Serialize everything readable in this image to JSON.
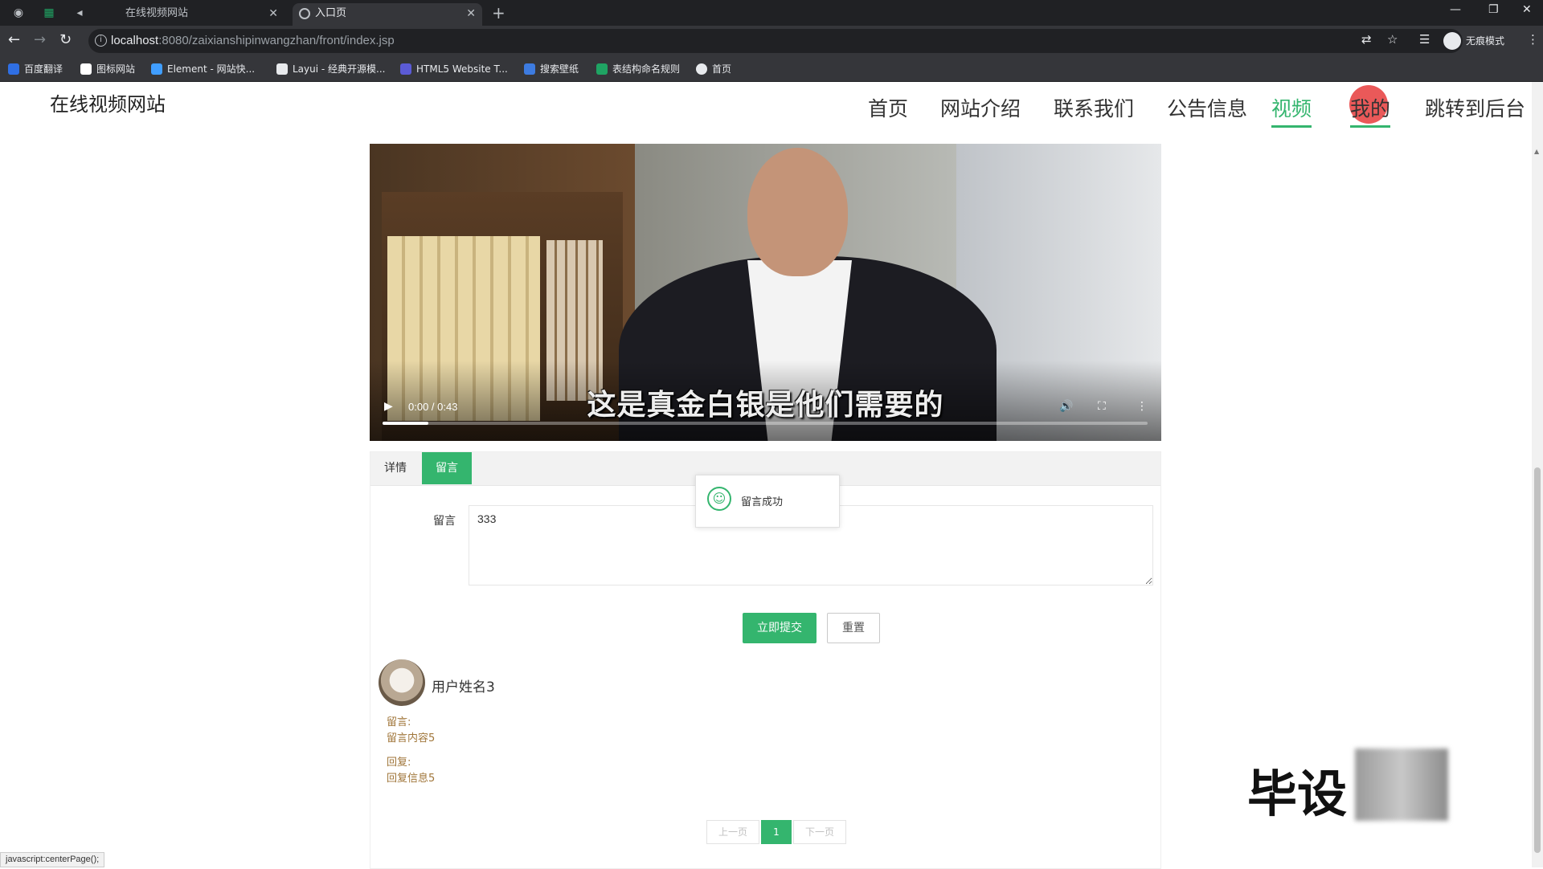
{
  "browser": {
    "tabs": [
      {
        "label": "在线视频网站"
      },
      {
        "label": "入口页"
      }
    ],
    "url_host": "localhost",
    "url_path": ":8080/zaixianshipinwangzhan/front/index.jsp",
    "profile_label": "无痕模式",
    "bookmarks": [
      {
        "label": "百度翻译",
        "color": "#2f6fe4"
      },
      {
        "label": "图标网站",
        "color": "#ffffff"
      },
      {
        "label": "Element - 网站快...",
        "color": "#409eff"
      },
      {
        "label": "Layui - 经典开源模...",
        "color": "#e8eaed"
      },
      {
        "label": "HTML5 Website T...",
        "color": "#5b5bd6"
      },
      {
        "label": "搜索壁纸",
        "color": "#3d7be0"
      },
      {
        "label": "表结构命名规则",
        "color": "#1fa463"
      },
      {
        "label": "首页",
        "color": "#e8eaed"
      }
    ]
  },
  "site": {
    "title": "在线视频网站",
    "nav": [
      "首页",
      "网站介绍",
      "联系我们",
      "公告信息",
      "视频",
      "我的",
      "跳转到后台"
    ],
    "active_nav": "视频",
    "accent_color": "#34b56e"
  },
  "video": {
    "subtitle": "这是真金白银是他们需要的",
    "time": "0:00 / 0:43",
    "progress": 0.06
  },
  "tabs": [
    "详情",
    "留言"
  ],
  "active_tab": "留言",
  "toast": {
    "message": "留言成功"
  },
  "form": {
    "label": "留言",
    "value": "333",
    "submit_label": "立即提交",
    "reset_label": "重置"
  },
  "comments": [
    {
      "user": "用户姓名3",
      "comment_label": "留言:",
      "comment": "留言内容5",
      "reply_label": "回复:",
      "reply": "回复信息5"
    }
  ],
  "pager": {
    "prev": "上一页",
    "current": "1",
    "next": "下一页"
  },
  "watermark": "毕设",
  "status_text": "javascript:centerPage();"
}
